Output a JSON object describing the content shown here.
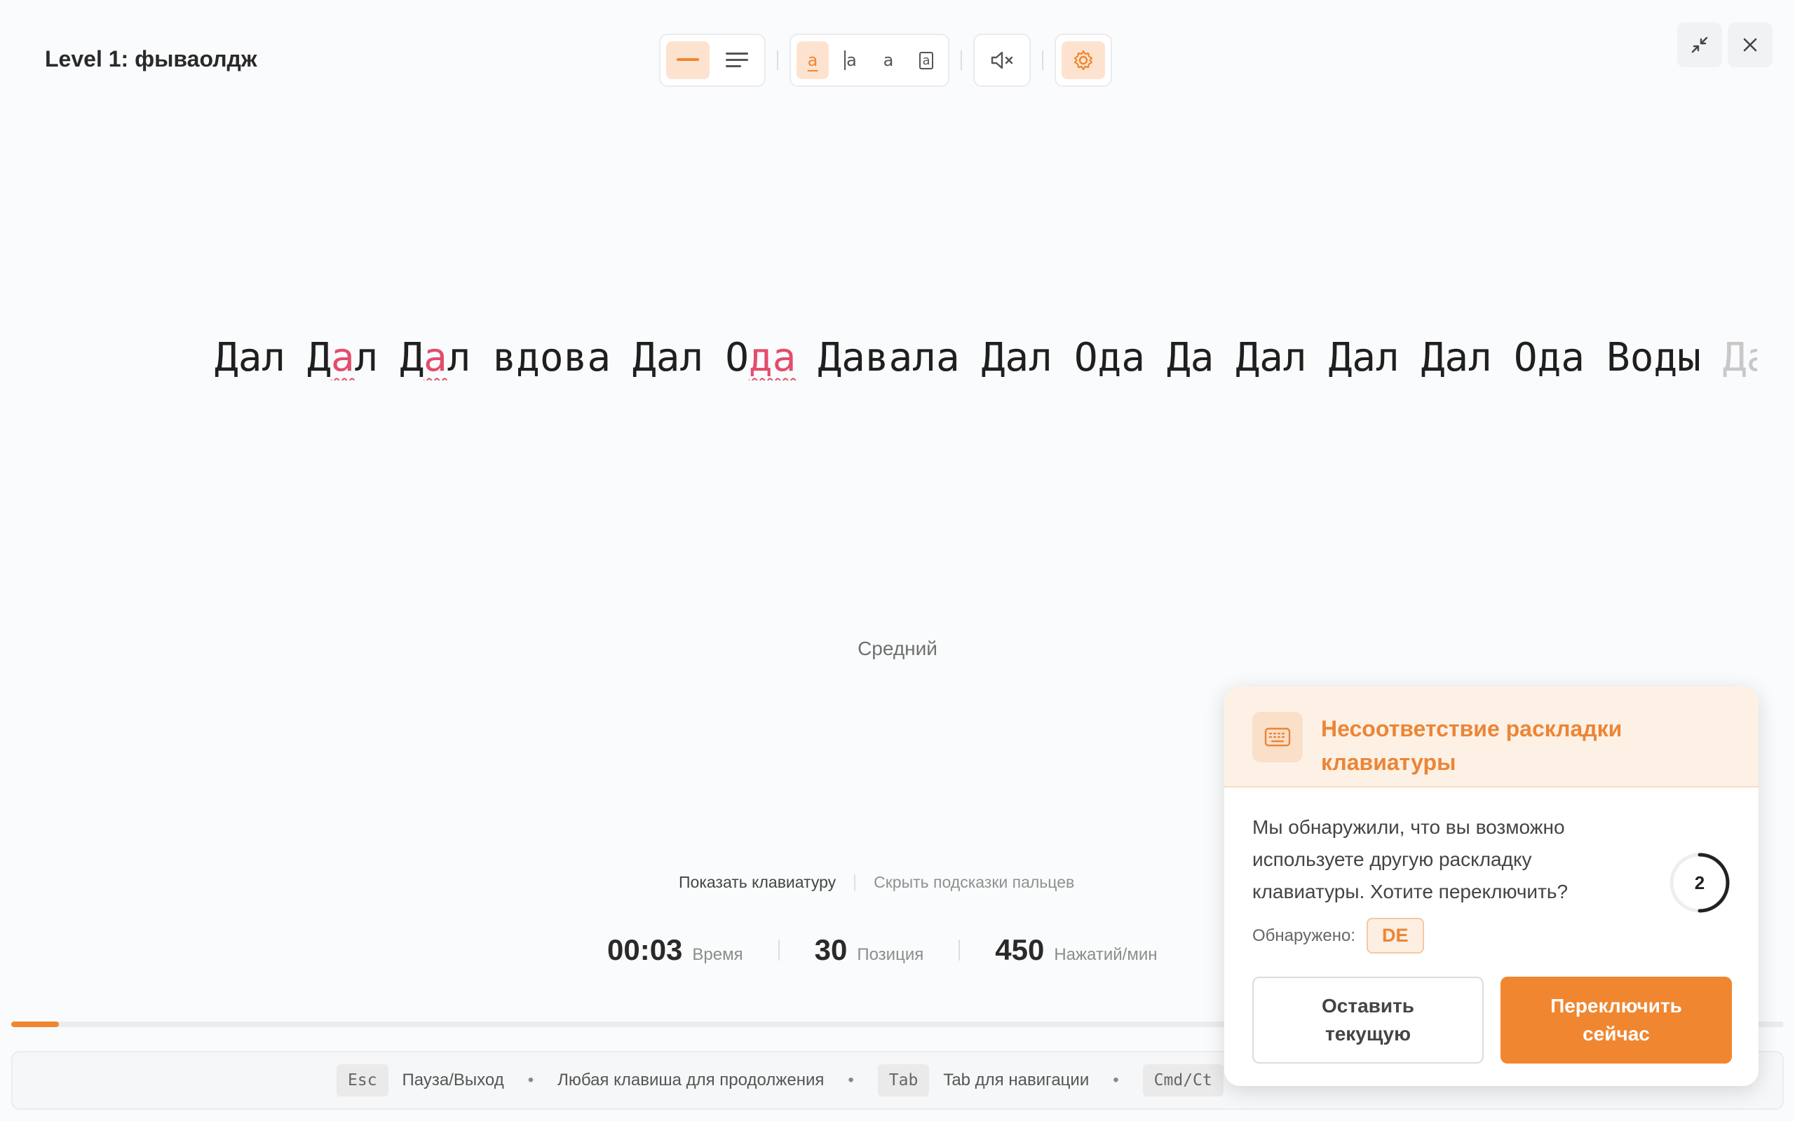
{
  "title": "Level 1: фываолдж",
  "toolbar": {
    "groups": [
      [
        "line-mode-icon",
        "paragraph-mode-icon"
      ],
      [
        "underline-cursor-icon",
        "bar-cursor-icon",
        "no-cursor-icon",
        "block-cursor-icon"
      ],
      [
        "sound-off-icon"
      ],
      [
        "settings-icon"
      ]
    ]
  },
  "words": [
    {
      "text": "Дал"
    },
    {
      "pre": "Д",
      "err": "а",
      "post": "л"
    },
    {
      "pre": "Д",
      "err": "а",
      "post": "л"
    },
    {
      "text": "вдова"
    },
    {
      "text": "Дал"
    },
    {
      "pre": "О",
      "err": "да",
      "post": ""
    },
    {
      "pre": "Дава",
      "cursor": "л",
      "post": "а"
    },
    {
      "text": "Дал"
    },
    {
      "text": "Ода"
    },
    {
      "text": "Да"
    },
    {
      "text": "Дал"
    },
    {
      "text": "Дал"
    },
    {
      "text": "Дал"
    },
    {
      "text": "Ода"
    },
    {
      "text": "Воды"
    },
    {
      "text": "Дав",
      "fade": true
    }
  ],
  "level_label": "Средний",
  "keyboard_links": {
    "show_keyboard": "Показать клавиатуру",
    "hide_hints": "Скрыть подсказки пальцев"
  },
  "stats": {
    "time": {
      "value": "00:03",
      "label": "Время"
    },
    "position": {
      "value": "30",
      "label": "Позиция"
    },
    "kpm": {
      "value": "450",
      "label": "Нажатий/мин"
    }
  },
  "progress_fraction": 0.027,
  "footer": {
    "esc_key": "Esc",
    "esc_label": "Пауза/Выход",
    "any_key": "Любая клавиша для продолжения",
    "tab_key": "Tab",
    "tab_label": "Tab для навигации",
    "cmd_key": "Cmd/Ct"
  },
  "popup": {
    "title": "Несоответствие раскладки клавиатуры",
    "message": "Мы обнаружили, что вы возможно используете другую раскладку клавиатуры. Хотите переключить?",
    "detected_label": "Обнаружено:",
    "detected_layout": "DE",
    "countdown": "2",
    "keep_button": "Оставить текущую",
    "switch_button": "Переключить сейчас"
  },
  "colors": {
    "accent": "#f0862f",
    "error": "#e34d6b",
    "popup_head": "#fdf1e6"
  }
}
